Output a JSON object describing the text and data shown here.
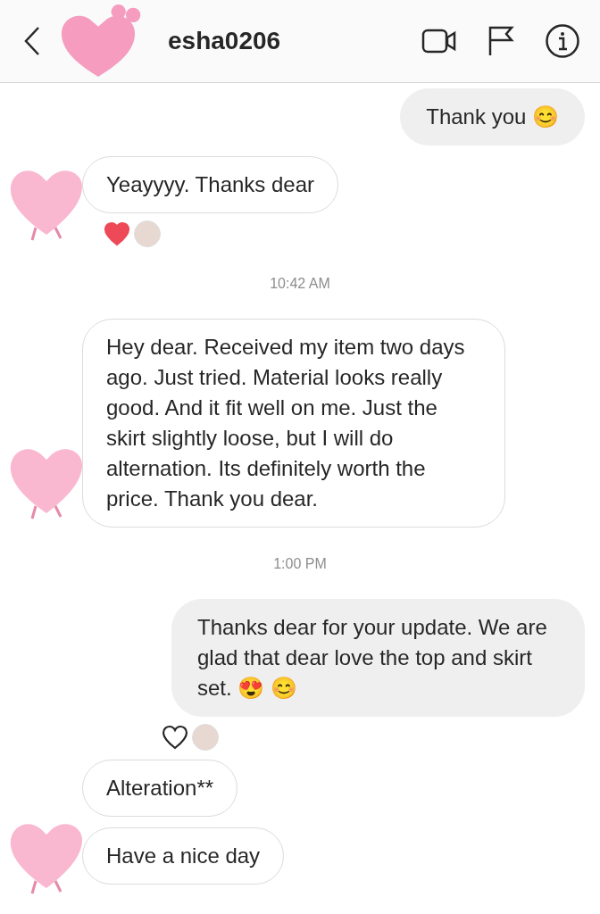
{
  "header": {
    "username": "esha0206"
  },
  "messages": [
    {
      "kind": "outgoing",
      "text": "Thank you 😊"
    },
    {
      "kind": "incoming",
      "text": "Yeayyyy. Thanks dear",
      "sticker": true,
      "reactions": [
        {
          "kind": "heart",
          "filled": true
        },
        {
          "kind": "avatar"
        }
      ]
    },
    {
      "kind": "time",
      "text": "10:42 AM"
    },
    {
      "kind": "incoming",
      "text": "Hey dear. Received my item two days ago. Just tried. Material looks really good. And it fit well on me. Just the skirt slightly loose, but I will do alternation. Its definitely worth the price. Thank you dear.",
      "sticker": true
    },
    {
      "kind": "time",
      "text": "1:00 PM"
    },
    {
      "kind": "outgoing",
      "text": "Thanks dear for your update. We are glad that dear love the top and skirt set. 😍 😊",
      "reactions": [
        {
          "kind": "heart",
          "filled": false
        },
        {
          "kind": "avatar"
        }
      ]
    },
    {
      "kind": "incoming",
      "text": "Alteration**"
    },
    {
      "kind": "incoming",
      "text": "Have a nice day",
      "sticker": true
    }
  ]
}
